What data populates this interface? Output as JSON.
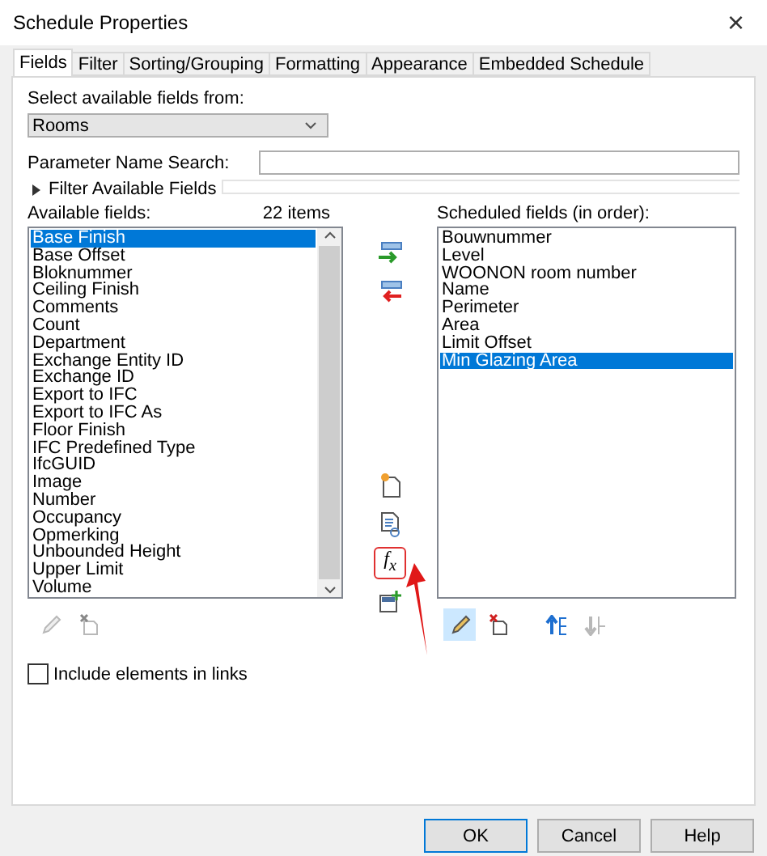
{
  "window": {
    "title": "Schedule Properties",
    "close": "×"
  },
  "tabs": [
    {
      "label": "Fields",
      "selected": true
    },
    {
      "label": "Filter",
      "selected": false
    },
    {
      "label": "Sorting/Grouping",
      "selected": false
    },
    {
      "label": "Formatting",
      "selected": false
    },
    {
      "label": "Appearance",
      "selected": false
    },
    {
      "label": "Embedded Schedule",
      "selected": false
    }
  ],
  "source": {
    "label": "Select available fields from:",
    "value": "Rooms"
  },
  "search": {
    "label": "Parameter Name Search:"
  },
  "filter_section": {
    "label": "Filter Available Fields",
    "expanded": false
  },
  "available": {
    "label": "Available fields:",
    "count": "22 items",
    "items": [
      {
        "label": "Base Finish",
        "selected": true
      },
      {
        "label": "Base Offset",
        "selected": false
      },
      {
        "label": "Bloknummer",
        "selected": false
      },
      {
        "label": "Ceiling Finish",
        "selected": false
      },
      {
        "label": "Comments",
        "selected": false
      },
      {
        "label": "Count",
        "selected": false
      },
      {
        "label": "Department",
        "selected": false
      },
      {
        "label": "Exchange Entity ID",
        "selected": false
      },
      {
        "label": "Exchange ID",
        "selected": false
      },
      {
        "label": "Export to IFC",
        "selected": false
      },
      {
        "label": "Export to IFC As",
        "selected": false
      },
      {
        "label": "Floor Finish",
        "selected": false
      },
      {
        "label": "IFC Predefined Type",
        "selected": false
      },
      {
        "label": "IfcGUID",
        "selected": false
      },
      {
        "label": "Image",
        "selected": false
      },
      {
        "label": "Number",
        "selected": false
      },
      {
        "label": "Occupancy",
        "selected": false
      },
      {
        "label": "Opmerking",
        "selected": false
      },
      {
        "label": "Unbounded Height",
        "selected": false
      },
      {
        "label": "Upper Limit",
        "selected": false
      },
      {
        "label": "Volume",
        "selected": false
      }
    ],
    "tools": [
      {
        "kind": "edit",
        "disabled": true
      },
      {
        "kind": "delete",
        "disabled": true
      }
    ]
  },
  "middle_tools": [
    {
      "kind": "add",
      "marked": false
    },
    {
      "kind": "remove",
      "marked": false
    },
    {
      "kind": "new-parameter",
      "marked": false
    },
    {
      "kind": "combine",
      "marked": false
    },
    {
      "kind": "formula",
      "marked": true,
      "label": "f$_{x}$"
    },
    {
      "kind": "add-calculated",
      "marked": false
    }
  ],
  "scheduled": {
    "label": "Scheduled fields (in order):",
    "items": [
      {
        "label": "Bouwnummer",
        "selected": false
      },
      {
        "label": "Level",
        "selected": false
      },
      {
        "label": "WOONON room number",
        "selected": false
      },
      {
        "label": "Name",
        "selected": false
      },
      {
        "label": "Perimeter",
        "selected": false
      },
      {
        "label": "Area",
        "selected": false
      },
      {
        "label": "Limit Offset",
        "selected": false
      },
      {
        "label": "Min Glazing Area",
        "selected": true
      }
    ],
    "tools": [
      {
        "kind": "edit",
        "disabled": false,
        "highlighted": true
      },
      {
        "kind": "delete",
        "disabled": false,
        "highlighted": false
      },
      {
        "kind": "move-up",
        "disabled": false,
        "highlighted": false
      },
      {
        "kind": "move-down",
        "disabled": true,
        "highlighted": false
      }
    ]
  },
  "include_links": {
    "label": "Include elements in links",
    "checked": false
  },
  "buttons": [
    {
      "label": "OK",
      "default": true
    },
    {
      "label": "Cancel",
      "default": false
    },
    {
      "label": "Help",
      "default": false
    }
  ]
}
